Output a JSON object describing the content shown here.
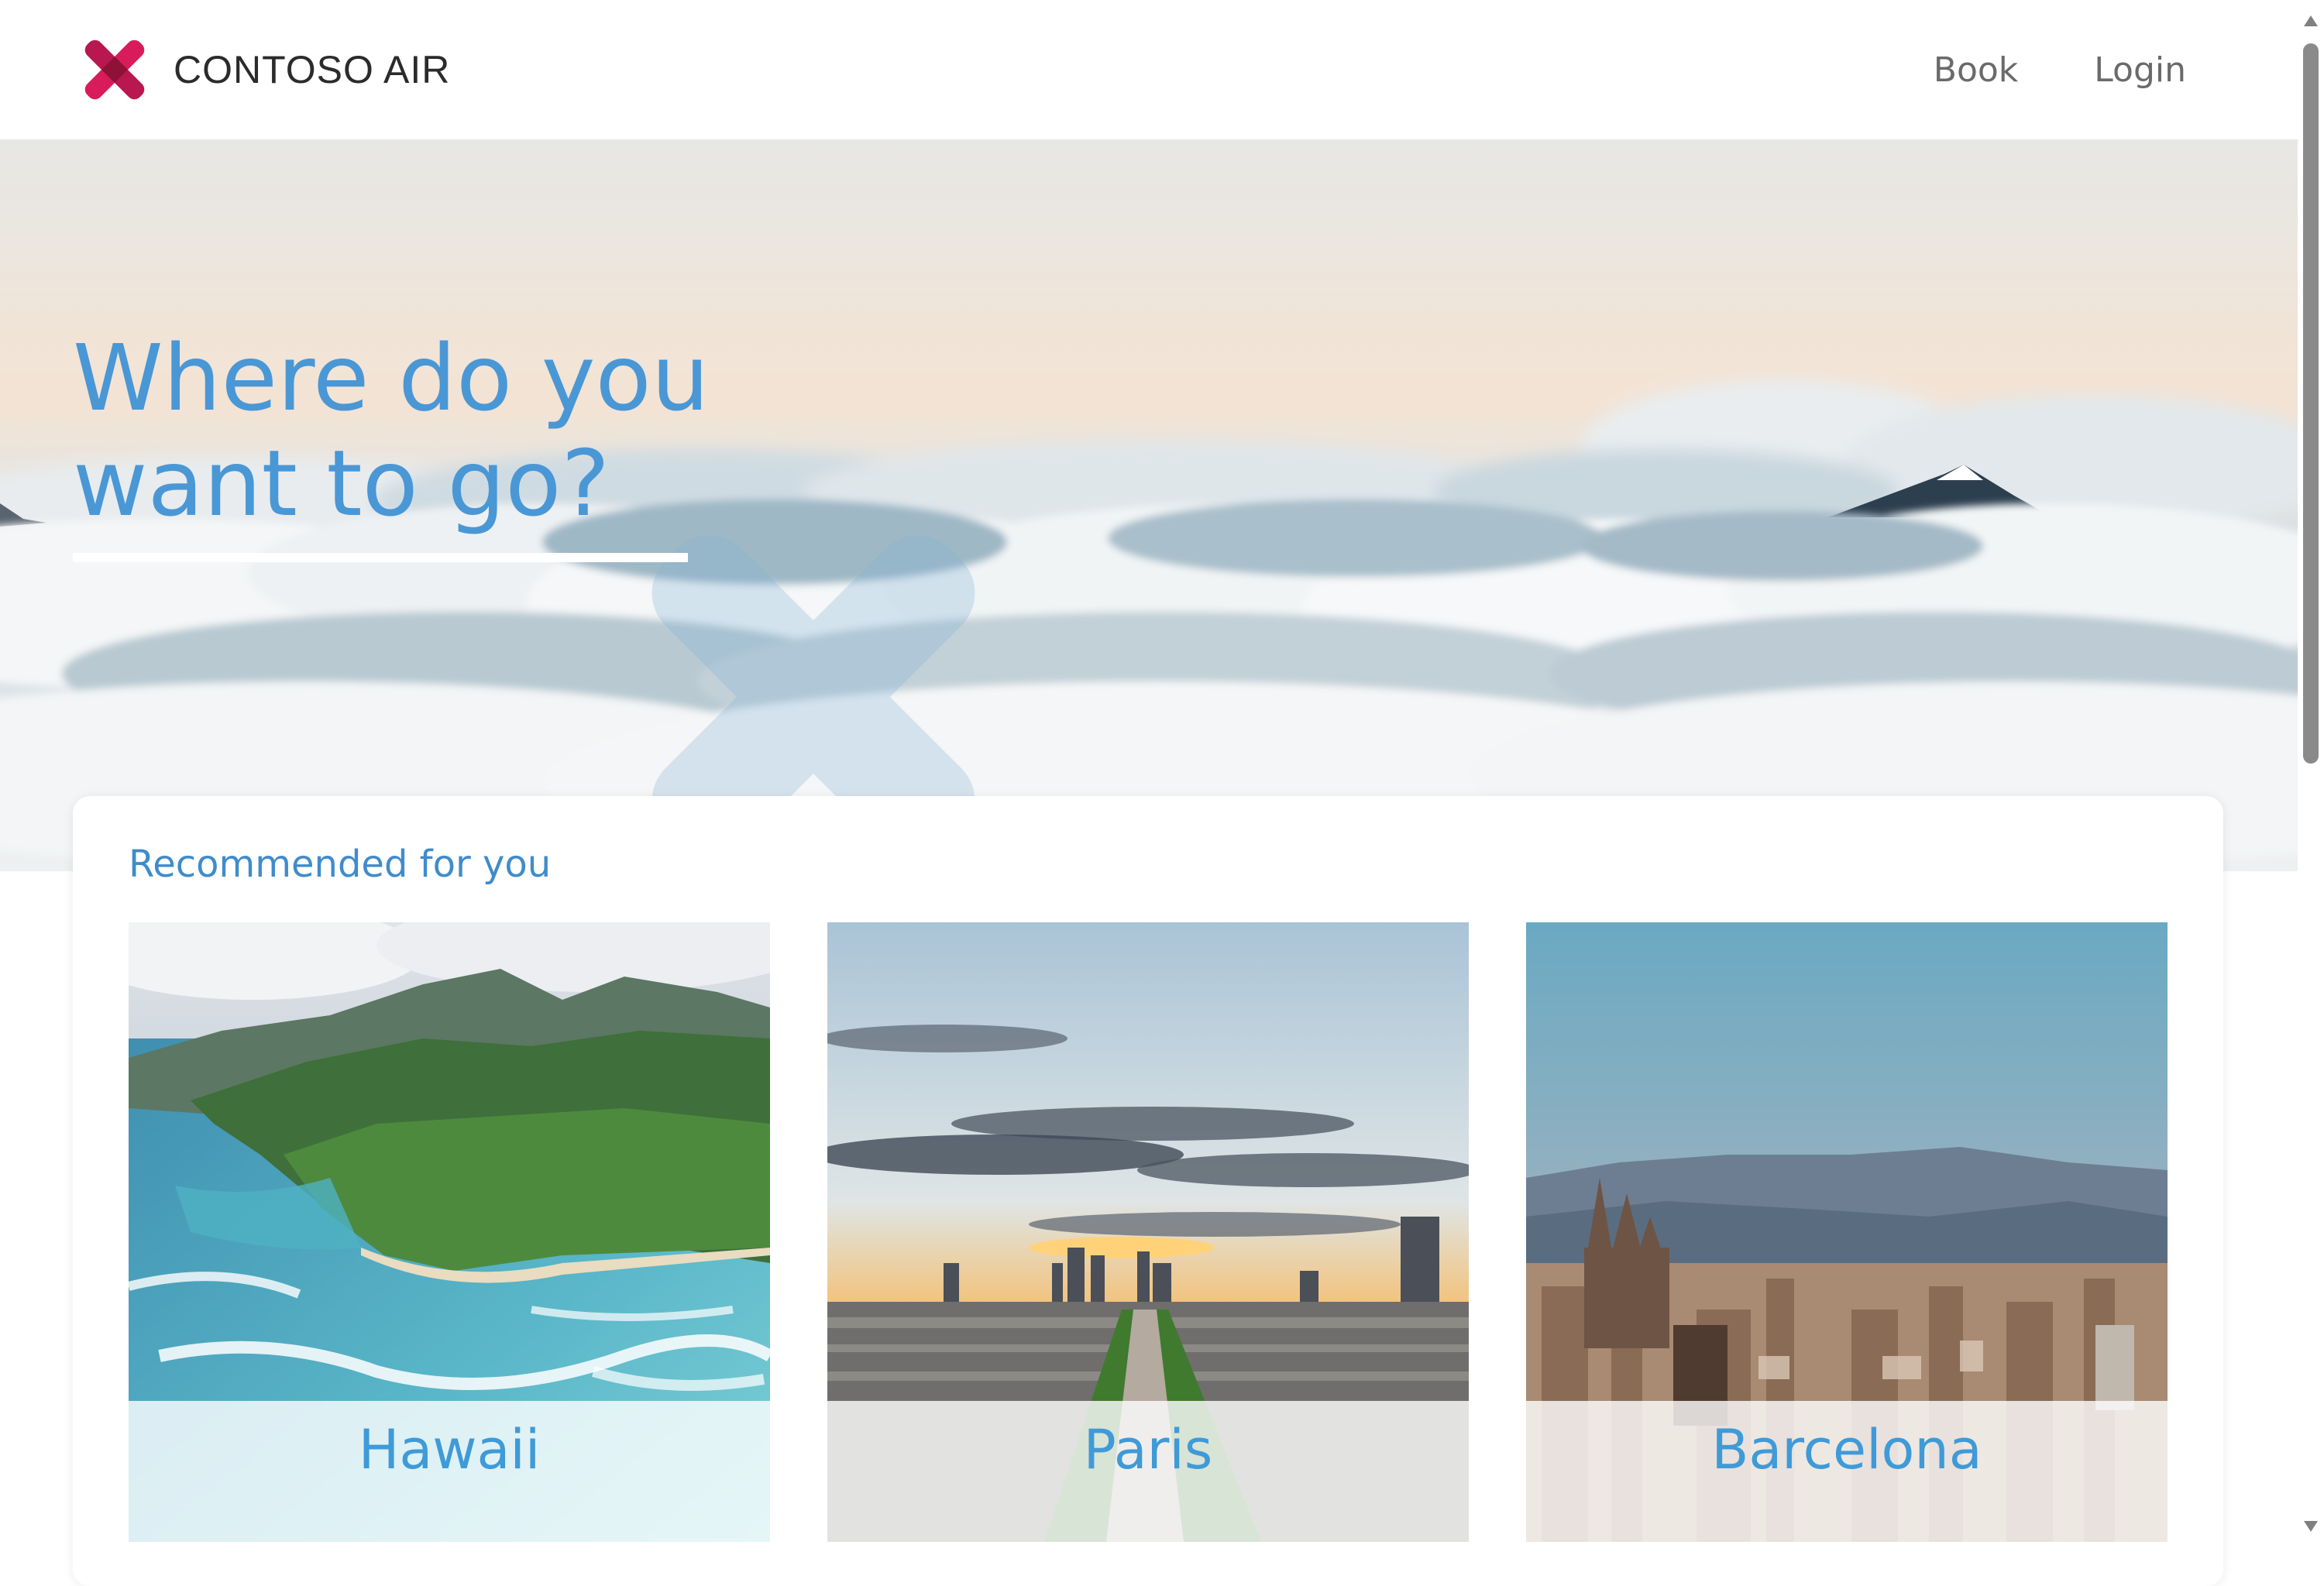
{
  "header": {
    "brand_name": "CONTOSO AIR",
    "nav": [
      {
        "label": "Book"
      },
      {
        "label": "Login"
      }
    ]
  },
  "hero": {
    "title": "Where do you\nwant to go?"
  },
  "recommended": {
    "title": "Recommended for you",
    "destinations": [
      {
        "name": "Hawaii"
      },
      {
        "name": "Paris"
      },
      {
        "name": "Barcelona"
      }
    ]
  },
  "colors": {
    "accent_blue": "#4a97d6",
    "logo_red": "#d81b5a",
    "logo_dark": "#9b1740"
  }
}
